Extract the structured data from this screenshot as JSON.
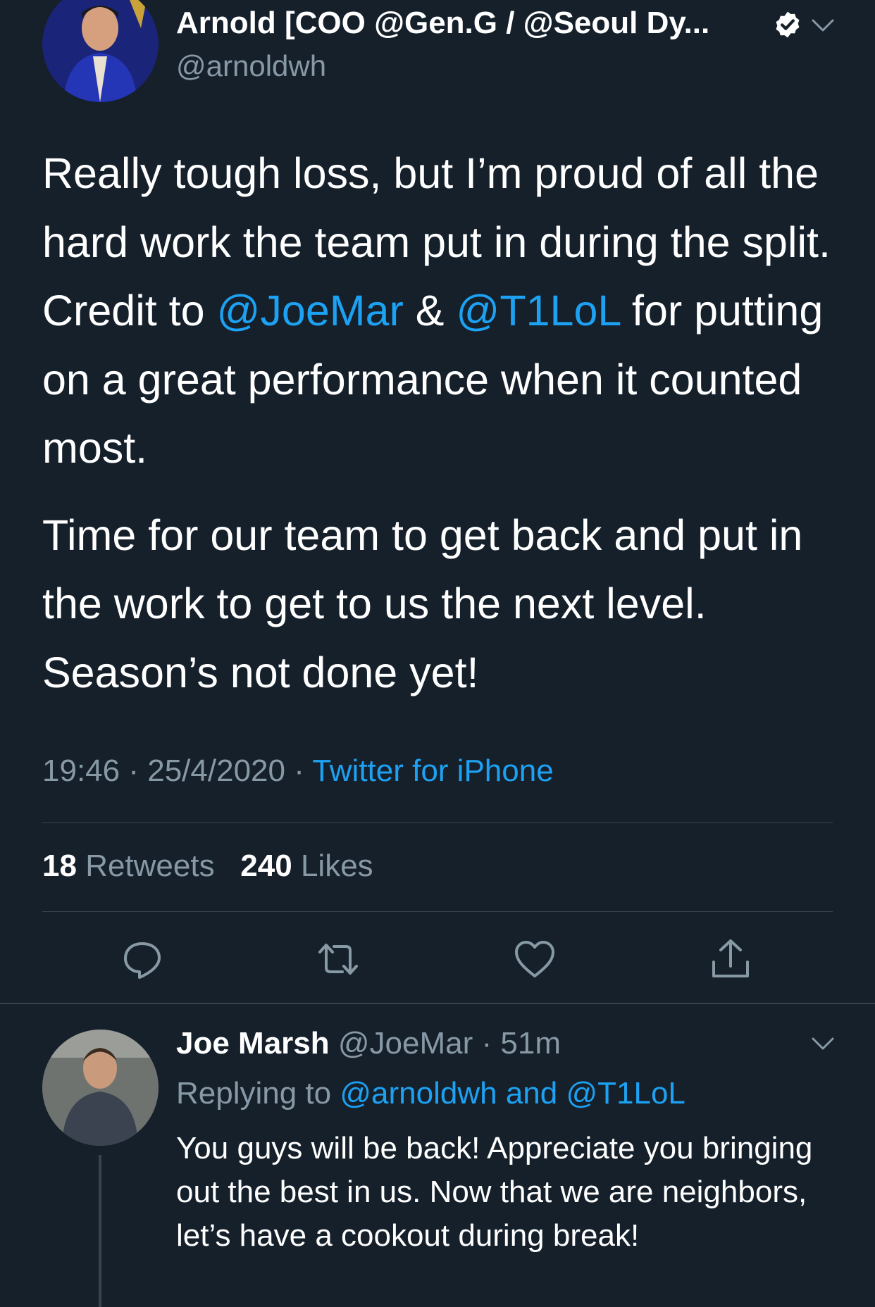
{
  "main_tweet": {
    "display_name": "Arnold [COO @Gen.G / @Seoul Dy...",
    "handle": "@arnoldwh",
    "paragraph1": {
      "part1": "Really tough loss, but I’m proud of all the hard work the team put in during the split. Credit to ",
      "mention1": "@JoeMar",
      "amp": " & ",
      "mention2": "@T1LoL",
      "part2": " for putting on a great performance when it counted most."
    },
    "paragraph2": "Time for our team to get back and put in the work to get to us the next level. Season’s not done yet!",
    "time": "19:46",
    "date": "25/4/2020",
    "source": "Twitter for iPhone",
    "retweets_count": "18",
    "retweets_label": "Retweets",
    "likes_count": "240",
    "likes_label": "Likes"
  },
  "reply": {
    "display_name": "Joe Marsh",
    "handle": "@JoeMar",
    "age": "51m",
    "replying_prefix": "Replying to",
    "replying_to": "@arnoldwh and @T1LoL",
    "text": "You guys will be back!  Appreciate you bringing out the best in us. Now that we are neighbors, let’s have a cookout during break!"
  },
  "colors": {
    "background": "#15202b",
    "link": "#1da1f2",
    "secondary_text": "#8899a6",
    "divider": "#38444d"
  },
  "icons": [
    "verified-badge-icon",
    "chevron-down-icon",
    "reply-icon",
    "retweet-icon",
    "like-icon",
    "share-icon"
  ]
}
